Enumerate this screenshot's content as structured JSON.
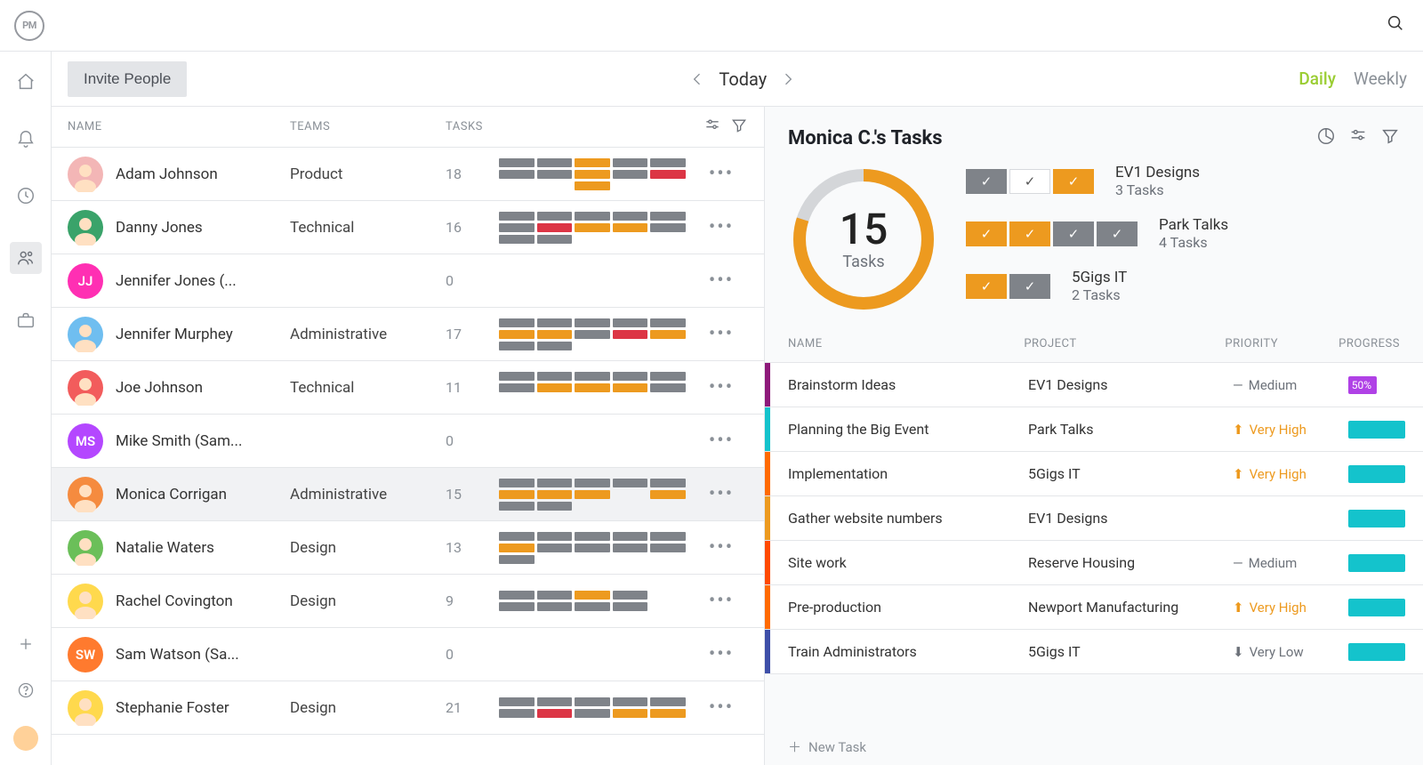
{
  "topbar": {
    "logo": "PM"
  },
  "toolbar": {
    "invite_label": "Invite People",
    "date_label": "Today",
    "views": {
      "daily": "Daily",
      "weekly": "Weekly",
      "active": "daily"
    }
  },
  "team_table": {
    "headers": {
      "name": "NAME",
      "teams": "TEAMS",
      "tasks": "TASKS"
    },
    "rows": [
      {
        "name": "Adam Johnson",
        "team": "Product",
        "count": "18",
        "avatar": {
          "bg": "#f3b6b6",
          "initials": ""
        },
        "bars": [
          [
            "g",
            "g",
            "o",
            "g",
            "g"
          ],
          [
            "g",
            "g",
            "o",
            "g",
            "r"
          ],
          [
            "e",
            "e",
            "o",
            "e",
            "e"
          ]
        ]
      },
      {
        "name": "Danny Jones",
        "team": "Technical",
        "count": "16",
        "avatar": {
          "bg": "#3aa36a",
          "initials": ""
        },
        "bars": [
          [
            "g",
            "g",
            "g",
            "g",
            "g"
          ],
          [
            "g",
            "r",
            "o",
            "o",
            "g"
          ],
          [
            "g",
            "g",
            "e",
            "e",
            "e"
          ]
        ]
      },
      {
        "name": "Jennifer Jones (...",
        "team": "",
        "count": "0",
        "avatar": {
          "bg": "#ff2fb3",
          "initials": "JJ"
        },
        "bars": []
      },
      {
        "name": "Jennifer Murphey",
        "team": "Administrative",
        "count": "17",
        "avatar": {
          "bg": "#6fbef0",
          "initials": ""
        },
        "bars": [
          [
            "g",
            "g",
            "g",
            "g",
            "g"
          ],
          [
            "o",
            "o",
            "g",
            "r",
            "o"
          ],
          [
            "g",
            "g",
            "e",
            "e",
            "e"
          ]
        ]
      },
      {
        "name": "Joe Johnson",
        "team": "Technical",
        "count": "11",
        "avatar": {
          "bg": "#f25c5c",
          "initials": ""
        },
        "bars": [
          [
            "g",
            "g",
            "g",
            "g",
            "g"
          ],
          [
            "g",
            "o",
            "o",
            "o",
            "g"
          ],
          [
            "e",
            "e",
            "e",
            "e",
            "e"
          ]
        ]
      },
      {
        "name": "Mike Smith (Sam...",
        "team": "",
        "count": "0",
        "avatar": {
          "bg": "#b447ff",
          "initials": "MS"
        },
        "bars": []
      },
      {
        "name": "Monica Corrigan",
        "team": "Administrative",
        "count": "15",
        "avatar": {
          "bg": "#f58b3f",
          "initials": ""
        },
        "bars": [
          [
            "g",
            "g",
            "g",
            "g",
            "g"
          ],
          [
            "o",
            "o",
            "o",
            "e",
            "o"
          ],
          [
            "g",
            "g",
            "e",
            "e",
            "e"
          ]
        ],
        "selected": true
      },
      {
        "name": "Natalie Waters",
        "team": "Design",
        "count": "13",
        "avatar": {
          "bg": "#6bbf59",
          "initials": ""
        },
        "bars": [
          [
            "g",
            "g",
            "g",
            "g",
            "g"
          ],
          [
            "o",
            "g",
            "g",
            "g",
            "g"
          ],
          [
            "g",
            "e",
            "e",
            "e",
            "e"
          ]
        ]
      },
      {
        "name": "Rachel Covington",
        "team": "Design",
        "count": "9",
        "avatar": {
          "bg": "#ffd94d",
          "initials": ""
        },
        "bars": [
          [
            "g",
            "g",
            "o",
            "g",
            "e"
          ],
          [
            "g",
            "g",
            "g",
            "g",
            "e"
          ]
        ]
      },
      {
        "name": "Sam Watson (Sa...",
        "team": "",
        "count": "0",
        "avatar": {
          "bg": "#ff7a2e",
          "initials": "SW"
        },
        "bars": []
      },
      {
        "name": "Stephanie Foster",
        "team": "Design",
        "count": "21",
        "avatar": {
          "bg": "#ffd94d",
          "initials": ""
        },
        "bars": [
          [
            "g",
            "g",
            "g",
            "g",
            "g"
          ],
          [
            "g",
            "r",
            "g",
            "o",
            "o"
          ]
        ]
      }
    ]
  },
  "detail": {
    "title": "Monica C.'s Tasks",
    "donut": {
      "value": "15",
      "label": "Tasks",
      "percent": 80,
      "color": "#ed9a1f",
      "track": "#7f8389"
    },
    "projects": [
      {
        "name": "EV1 Designs",
        "count": "3 Tasks",
        "chips": [
          "g",
          "w",
          "o"
        ]
      },
      {
        "name": "Park Talks",
        "count": "4 Tasks",
        "chips": [
          "o",
          "o",
          "g",
          "g"
        ]
      },
      {
        "name": "5Gigs IT",
        "count": "2 Tasks",
        "chips": [
          "o",
          "g"
        ]
      }
    ],
    "task_headers": {
      "name": "NAME",
      "project": "PROJECT",
      "priority": "PRIORITY",
      "progress": "PROGRESS"
    },
    "tasks": [
      {
        "name": "Brainstorm Ideas",
        "project": "EV1 Designs",
        "priority": "Medium",
        "prio_class": "med",
        "stripe": "#8e1a7a",
        "progress": 50,
        "prog_color": "#b041e6",
        "prog_label": "50%"
      },
      {
        "name": "Planning the Big Event",
        "project": "Park Talks",
        "priority": "Very High",
        "prio_class": "vh",
        "stripe": "#14c3cc",
        "progress": 100,
        "prog_color": "#14c3cc"
      },
      {
        "name": "Implementation",
        "project": "5Gigs IT",
        "priority": "Very High",
        "prio_class": "vh",
        "stripe": "#ff6a00",
        "progress": 100,
        "prog_color": "#14c3cc"
      },
      {
        "name": "Gather website numbers",
        "project": "EV1 Designs",
        "priority": "",
        "prio_class": "",
        "stripe": "#ed9a1f",
        "progress": 100,
        "prog_color": "#14c3cc"
      },
      {
        "name": "Site work",
        "project": "Reserve Housing",
        "priority": "Medium",
        "prio_class": "med",
        "stripe": "#ff4a00",
        "progress": 100,
        "prog_color": "#14c3cc"
      },
      {
        "name": "Pre-production",
        "project": "Newport Manufacturing",
        "priority": "Very High",
        "prio_class": "vh",
        "stripe": "#ff6a00",
        "progress": 100,
        "prog_color": "#14c3cc"
      },
      {
        "name": "Train Administrators",
        "project": "5Gigs IT",
        "priority": "Very Low",
        "prio_class": "vl",
        "stripe": "#3e4fa8",
        "progress": 100,
        "prog_color": "#14c3cc"
      }
    ],
    "new_task": "New Task"
  }
}
